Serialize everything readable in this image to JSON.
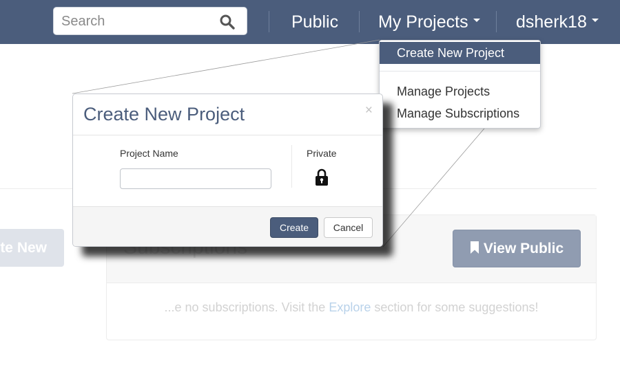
{
  "navbar": {
    "search": {
      "placeholder": "Search",
      "value": "",
      "icon": "search-icon"
    },
    "public_label": "Public",
    "my_projects_label": "My Projects",
    "user_label": "dsherk18",
    "background_color": "#4b5d7c"
  },
  "dropdown": {
    "items": [
      {
        "label": "Create New Project",
        "active": true
      },
      {
        "label": "Manage Projects",
        "active": false
      },
      {
        "label": "Manage Subscriptions",
        "active": false
      }
    ]
  },
  "background_page": {
    "create_new_label": "te New",
    "subscriptions_title": "Subscriptions",
    "view_public_label": "View Public",
    "view_public_icon": "bookmark-icon",
    "empty_message_prefix": "...e no subscriptions. Visit the ",
    "empty_message_link": "Explore",
    "empty_message_suffix": " section for some suggestions!"
  },
  "modal": {
    "title": "Create New Project",
    "close_glyph": "×",
    "project_name_label": "Project Name",
    "project_name_value": "",
    "private_label": "Private",
    "private_icon": "lock-icon",
    "create_label": "Create",
    "cancel_label": "Cancel",
    "accent_color": "#4b5d7c"
  }
}
